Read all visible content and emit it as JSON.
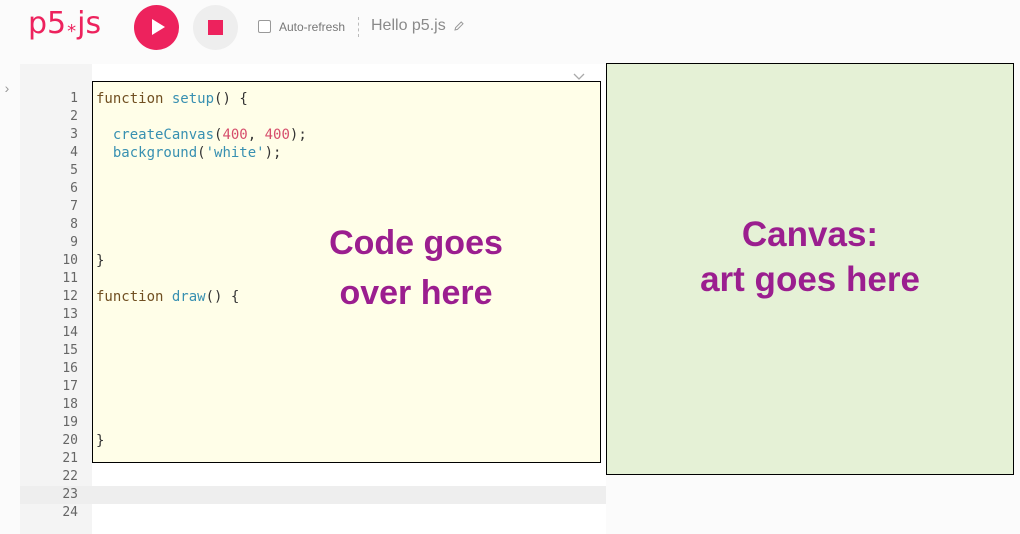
{
  "toolbar": {
    "logo_text": "p5",
    "logo_star": "*",
    "logo_suffix": "js",
    "auto_refresh_label": "Auto-refresh",
    "auto_refresh_checked": false,
    "project_name": "Hello p5.js"
  },
  "editor": {
    "line_numbers": [
      "1",
      "2",
      "3",
      "4",
      "5",
      "6",
      "7",
      "8",
      "9",
      "10",
      "11",
      "12",
      "13",
      "14",
      "15",
      "16",
      "17",
      "18",
      "19",
      "20",
      "21",
      "22",
      "23",
      "24"
    ],
    "active_line": "23",
    "code": {
      "l1_kw": "function",
      "l1_fn": "setup",
      "l1_rest": "() {",
      "l3_fn": "createCanvas",
      "l3_open": "(",
      "l3_n1": "400",
      "l3_sep": ", ",
      "l3_n2": "400",
      "l3_close": ");",
      "l4_fn": "background",
      "l4_open": "(",
      "l4_str": "'white'",
      "l4_close": ");",
      "l10": "}",
      "l12_kw": "function",
      "l12_fn": "draw",
      "l12_rest": "() {",
      "l20": "}"
    },
    "annotation_line1": "Code goes",
    "annotation_line2": "over here"
  },
  "canvas": {
    "annotation_line1": "Canvas:",
    "annotation_line2": "art goes here"
  },
  "colors": {
    "brand": "#ed225d",
    "annotation": "#9b1e8f",
    "code_bg": "#fffee8",
    "canvas_bg": "#e5f1d6"
  }
}
